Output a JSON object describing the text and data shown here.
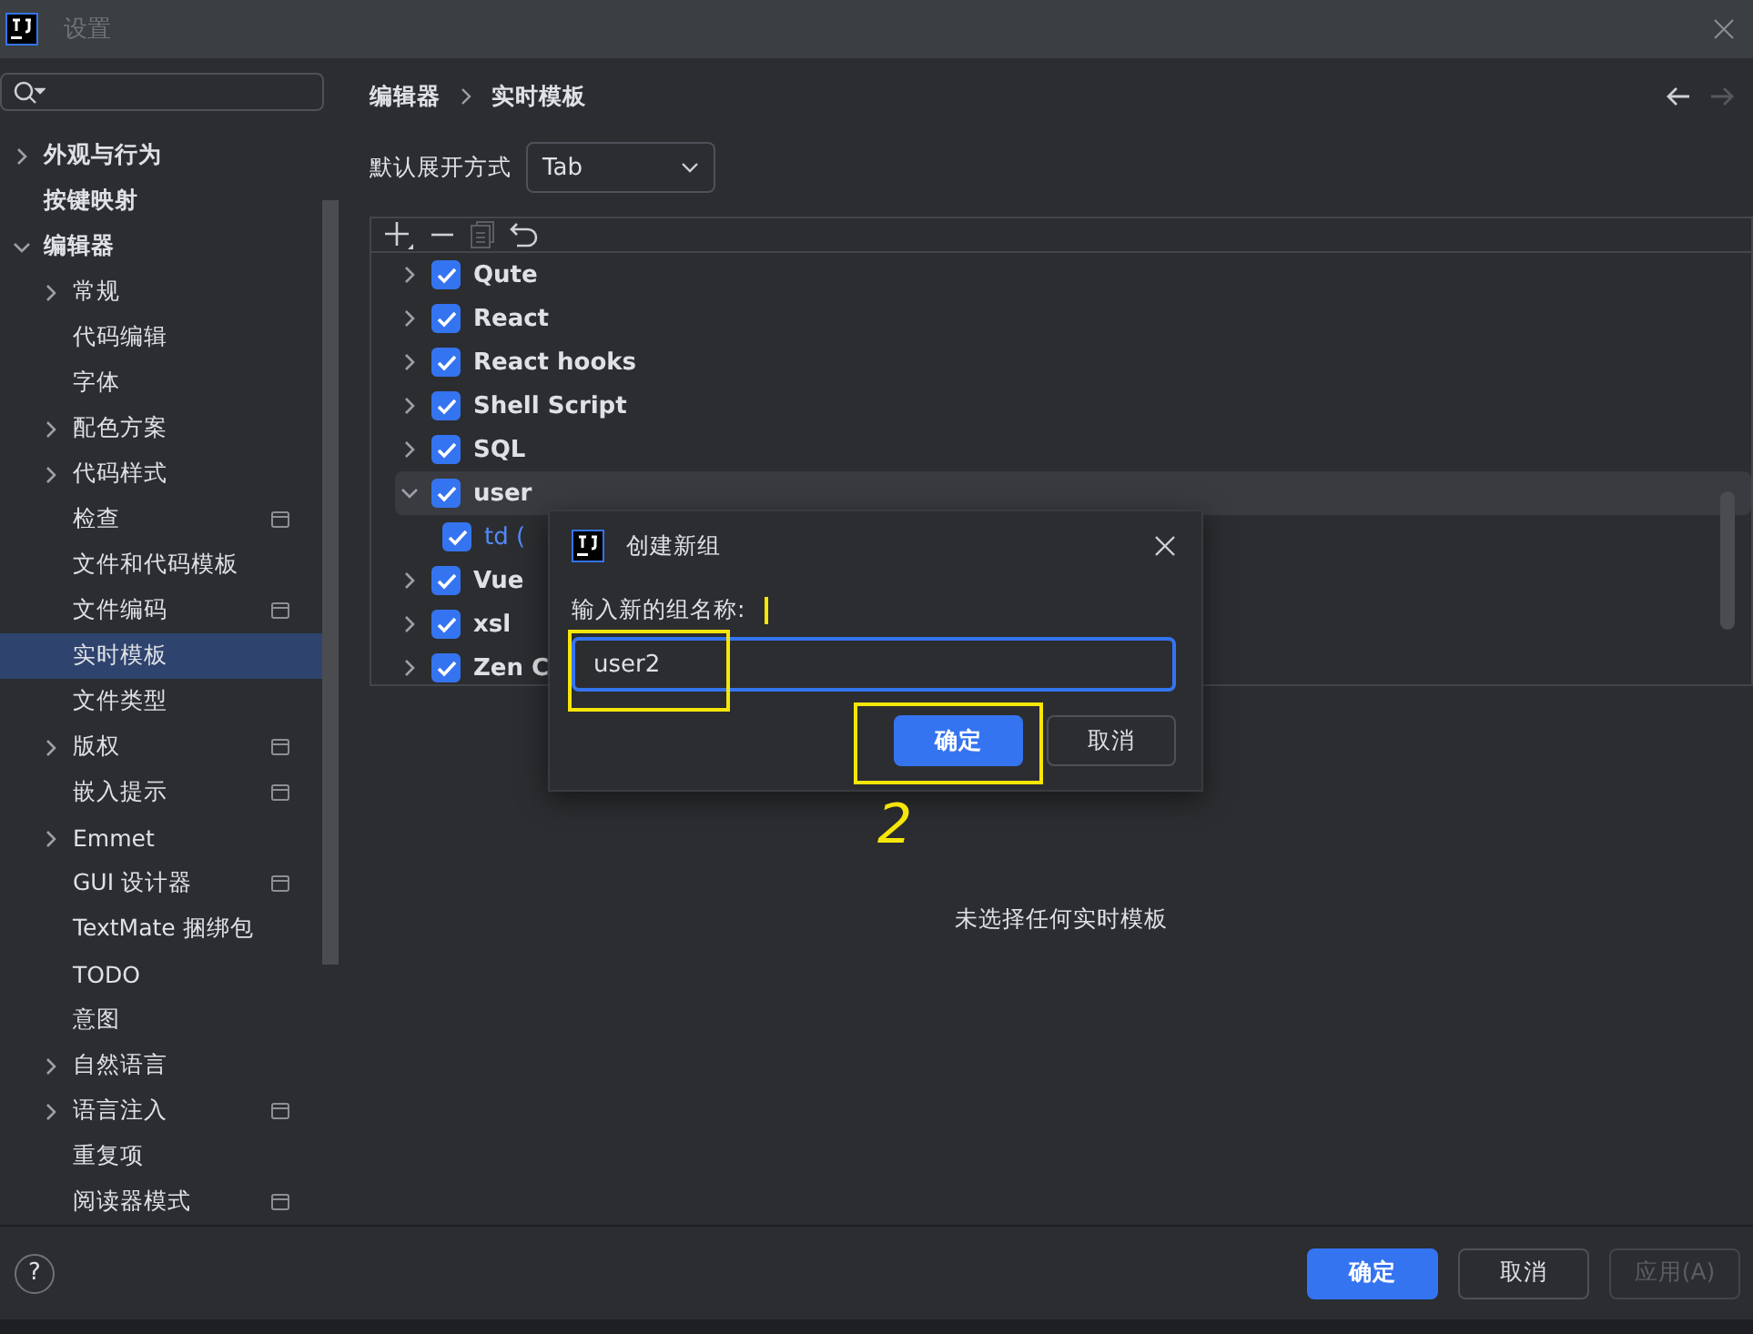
{
  "window": {
    "title": "设置"
  },
  "sidebar": {
    "items": [
      {
        "label": "外观与行为",
        "expanded": false,
        "selected": false
      },
      {
        "label": "按键映射",
        "selected": false
      },
      {
        "label": "编辑器",
        "expanded": true,
        "selected": false,
        "children": [
          {
            "label": "常规",
            "expanded": false,
            "selected": false,
            "project": false
          },
          {
            "label": "代码编辑",
            "selected": false,
            "project": false
          },
          {
            "label": "字体",
            "selected": false,
            "project": false
          },
          {
            "label": "配色方案",
            "expanded": false,
            "selected": false,
            "project": false
          },
          {
            "label": "代码样式",
            "expanded": false,
            "selected": false,
            "project": false
          },
          {
            "label": "检查",
            "selected": false,
            "project": true
          },
          {
            "label": "文件和代码模板",
            "selected": false,
            "project": false
          },
          {
            "label": "文件编码",
            "selected": false,
            "project": true
          },
          {
            "label": "实时模板",
            "selected": true,
            "project": false
          },
          {
            "label": "文件类型",
            "selected": false,
            "project": false
          },
          {
            "label": "版权",
            "expanded": false,
            "selected": false,
            "project": true
          },
          {
            "label": "嵌入提示",
            "selected": false,
            "project": true
          },
          {
            "label": "Emmet",
            "expanded": false,
            "selected": false,
            "project": false
          },
          {
            "label": "GUI 设计器",
            "selected": false,
            "project": true
          },
          {
            "label": "TextMate 捆绑包",
            "selected": false,
            "project": false
          },
          {
            "label": "TODO",
            "selected": false,
            "project": false
          },
          {
            "label": "意图",
            "selected": false,
            "project": false
          },
          {
            "label": "自然语言",
            "expanded": false,
            "selected": false,
            "project": false
          },
          {
            "label": "语言注入",
            "expanded": false,
            "selected": false,
            "project": true
          },
          {
            "label": "重复项",
            "selected": false,
            "project": false
          },
          {
            "label": "阅读器模式",
            "selected": false,
            "project": true
          }
        ]
      }
    ]
  },
  "breadcrumb": [
    "编辑器",
    "实时模板"
  ],
  "expand_with": {
    "label": "默认展开方式",
    "value": "Tab"
  },
  "templates": [
    {
      "name": "Qute",
      "checked": true,
      "expanded": false,
      "selected": false
    },
    {
      "name": "React",
      "checked": true,
      "expanded": false,
      "selected": false
    },
    {
      "name": "React hooks",
      "checked": true,
      "expanded": false,
      "selected": false
    },
    {
      "name": "Shell Script",
      "checked": true,
      "expanded": false,
      "selected": false
    },
    {
      "name": "SQL",
      "checked": true,
      "expanded": false,
      "selected": false
    },
    {
      "name": "user",
      "checked": true,
      "expanded": true,
      "selected": true,
      "children": [
        {
          "name": "td (",
          "checked": true
        }
      ]
    },
    {
      "name": "Vue",
      "checked": true,
      "expanded": false,
      "selected": false
    },
    {
      "name": "xsl",
      "checked": true,
      "expanded": false,
      "selected": false
    },
    {
      "name": "Zen C",
      "checked": true,
      "expanded": false,
      "selected": false
    }
  ],
  "empty_message": "未选择任何实时模板",
  "dialog": {
    "title": "创建新组",
    "label": "输入新的组名称:",
    "value": "user2",
    "buttons": [
      {
        "label": "确定",
        "primary": true
      },
      {
        "label": "取消",
        "primary": false
      }
    ]
  },
  "annotation": {
    "label": "2"
  },
  "footer": {
    "help": "?",
    "buttons": [
      {
        "label": "确定",
        "primary": true,
        "disabled": false
      },
      {
        "label": "取消",
        "primary": false,
        "disabled": false
      },
      {
        "label": "应用(A)",
        "primary": false,
        "disabled": true
      }
    ]
  }
}
